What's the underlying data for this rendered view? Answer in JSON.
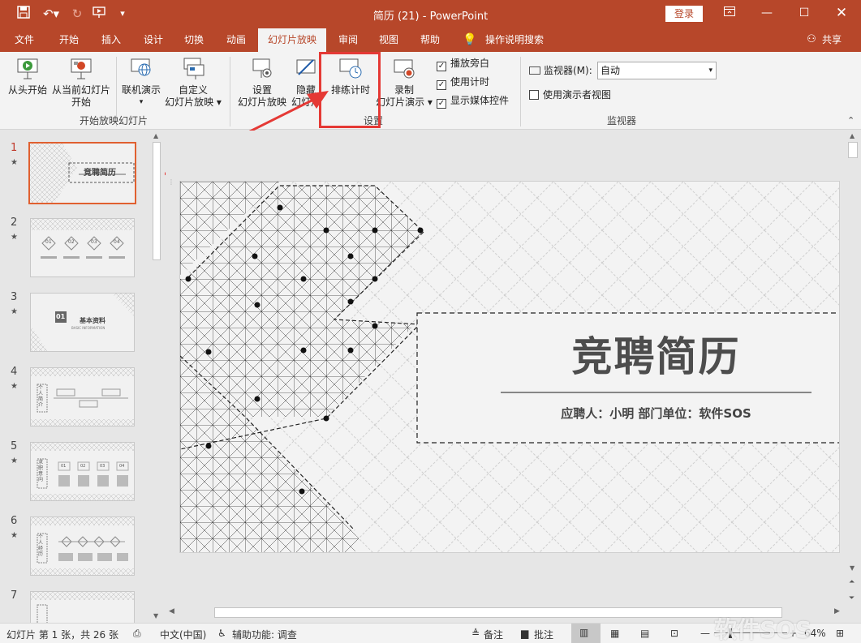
{
  "window": {
    "title": "简历 (21)  -  PowerPoint",
    "signin": "登录",
    "share": "共享"
  },
  "tabs": [
    "文件",
    "开始",
    "插入",
    "设计",
    "切换",
    "动画",
    "幻灯片放映",
    "审阅",
    "视图",
    "帮助",
    "操作说明搜索"
  ],
  "active_tab": "幻灯片放映",
  "ribbon": {
    "from_start": "从头开始",
    "from_current_1": "从当前幻灯片",
    "from_current_2": "开始",
    "online_present": "联机演示",
    "custom_show_1": "自定义",
    "custom_show_2": "幻灯片放映",
    "group_start": "开始放映幻灯片",
    "setup_1": "设置",
    "setup_2": "幻灯片放映",
    "hide_1": "隐藏",
    "hide_2": "幻灯片",
    "rehearse": "排练计时",
    "record_1": "录制",
    "record_2": "幻灯片演示",
    "play_narrations": "播放旁白",
    "use_timings": "使用计时",
    "show_media_controls": "显示媒体控件",
    "group_setup": "设置",
    "monitor_label": "监视器(M):",
    "monitor_value": "自动",
    "presenter_view": "使用演示者视图",
    "group_monitors": "监视器"
  },
  "thumbnails": [
    {
      "num": "1",
      "star": "★",
      "title": "竞聘简历"
    },
    {
      "num": "2",
      "star": "★",
      "items": [
        "01",
        "02",
        "03",
        "04"
      ]
    },
    {
      "num": "3",
      "star": "★",
      "badge": "01",
      "title": "基本资料",
      "subtitle": "BASIC INFORMATION"
    },
    {
      "num": "4",
      "star": "★",
      "side": "个人简介"
    },
    {
      "num": "5",
      "star": "★",
      "side": "求职意向",
      "items": [
        "01",
        "02",
        "03",
        "04"
      ]
    },
    {
      "num": "6",
      "star": "★",
      "side": "个人经历"
    },
    {
      "num": "7",
      "star": ""
    }
  ],
  "slide": {
    "title": "竞聘简历",
    "subtitle": "应聘人：小明  部门单位：软件SOS"
  },
  "status": {
    "slide_info": "幻灯片 第 1 张，共 26 张",
    "language": "中文(中国)",
    "accessibility": "辅助功能: 调查",
    "notes": "备注",
    "comments": "批注",
    "zoom": "64%"
  },
  "watermark": "软件SOS",
  "colors": {
    "accent": "#b7472a",
    "highlight": "#e53935"
  }
}
